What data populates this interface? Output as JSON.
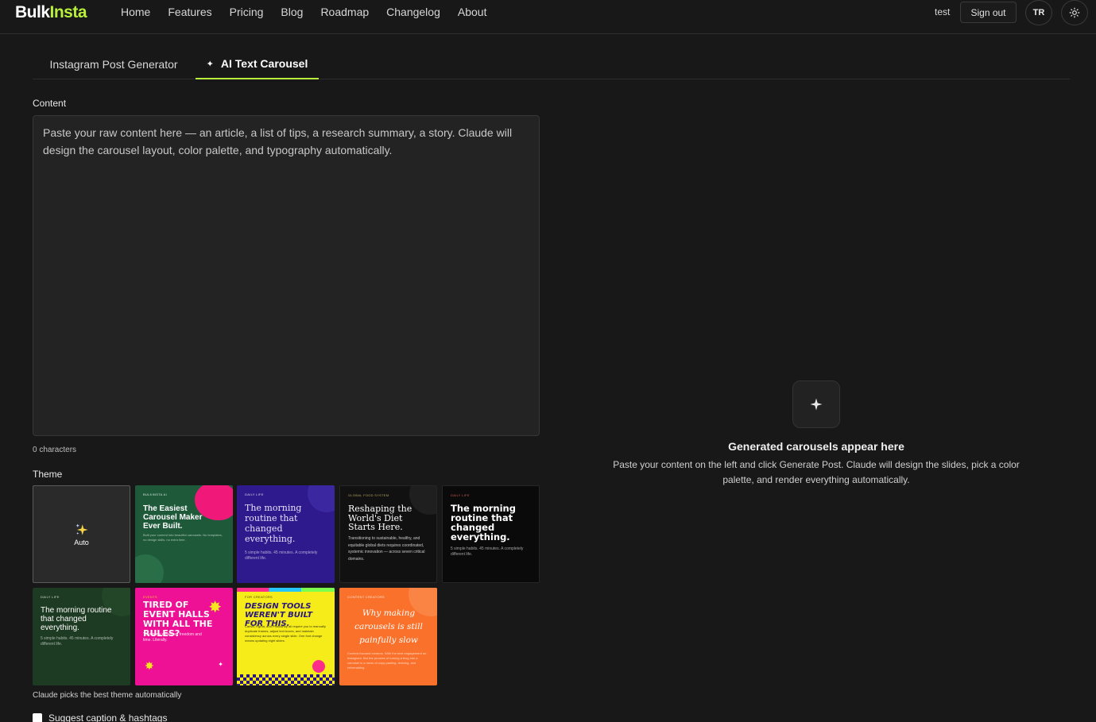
{
  "header": {
    "logo_part1": "Bulk",
    "logo_part2": "Insta",
    "nav": [
      "Home",
      "Features",
      "Pricing",
      "Blog",
      "Roadmap",
      "Changelog",
      "About"
    ],
    "user_name": "test",
    "signout_label": "Sign out",
    "avatar_initials": "TR"
  },
  "tabs": {
    "generator": "Instagram Post Generator",
    "carousel": "AI Text Carousel"
  },
  "content": {
    "label": "Content",
    "placeholder": "Paste your raw content here — an article, a list of tips, a research summary, a story. Claude will design the carousel layout, color palette, and typography automatically.",
    "value": "",
    "char_count": "0 characters"
  },
  "theme": {
    "label": "Theme",
    "auto_label": "Auto",
    "cards": [
      {
        "title": "The Easiest Carousel Maker Ever Built.",
        "kicker": "BULKINSTA AI",
        "desc": "Built your content into beautiful carousels. No templates, no design skills, no extra time.",
        "bg": "#1e5a3a",
        "fg": "#ffffff",
        "accent": "#f0197a"
      },
      {
        "title": "The morning routine that changed everything.",
        "kicker": "DAILY LIFE",
        "desc": "5 simple habits. 45 minutes. A completely different life.",
        "bg": "#2e1a8c",
        "fg": "#ffffff"
      },
      {
        "title": "Reshaping the World's Diet Starts Here.",
        "kicker": "GLOBAL FOOD SYSTEM",
        "desc": "Transitioning to sustainable, healthy, and equitable global diets requires coordinated, systemic innovation — across seven critical domains.",
        "bg": "#111111",
        "fg": "#ffffff"
      },
      {
        "title": "The morning routine that changed everything.",
        "kicker": "DAILY LIFE",
        "desc": "5 simple habits. 45 minutes. A completely different life.",
        "bg": "#0a0a0a",
        "fg": "#ffffff"
      },
      {
        "title": "The morning routine that changed everything.",
        "kicker": "DAILY LIFE",
        "desc": "5 simple habits. 45 minutes. A completely different life.",
        "bg": "#1d3a22",
        "fg": "#ffffff"
      },
      {
        "title": "TIRED OF EVENT HALLS WITH ALL THE RULES?",
        "kicker": "EVENTS",
        "desc": "Your party deserves freedom and time. Literally.",
        "bg": "#ee1196",
        "fg": "#ffffff",
        "accent": "#f7e51f"
      },
      {
        "title": "DESIGN TOOLS WEREN'T BUILT FOR THIS.",
        "kicker": "FOR CREATORS",
        "desc": "Canva, Figma, and Photoshop all require you to manually duplicate frames, adjust text boxes, and maintain consistency across every single slide. One font change means updating eight slides.",
        "bg": "#f6ec1a",
        "fg": "#111111",
        "accent": "#2a1780"
      },
      {
        "title": "Why making carousels is still painfully slow",
        "kicker": "CONTENT CREATORS",
        "desc": "Content-focused creators. With the best engagement on Instagram. But the process of turning a blog into a carousel is a mess of copy-pasting, resizing, and reformatting.",
        "bg": "#f9712a",
        "fg": "#ffffff"
      }
    ],
    "helper": "Claude picks the best theme automatically"
  },
  "suggest": {
    "label": "Suggest caption & hashtags",
    "checked": false
  },
  "empty_state": {
    "title": "Generated carousels appear here",
    "desc": "Paste your content on the left and click Generate Post. Claude will design the slides, pick a color palette, and render everything automatically."
  }
}
